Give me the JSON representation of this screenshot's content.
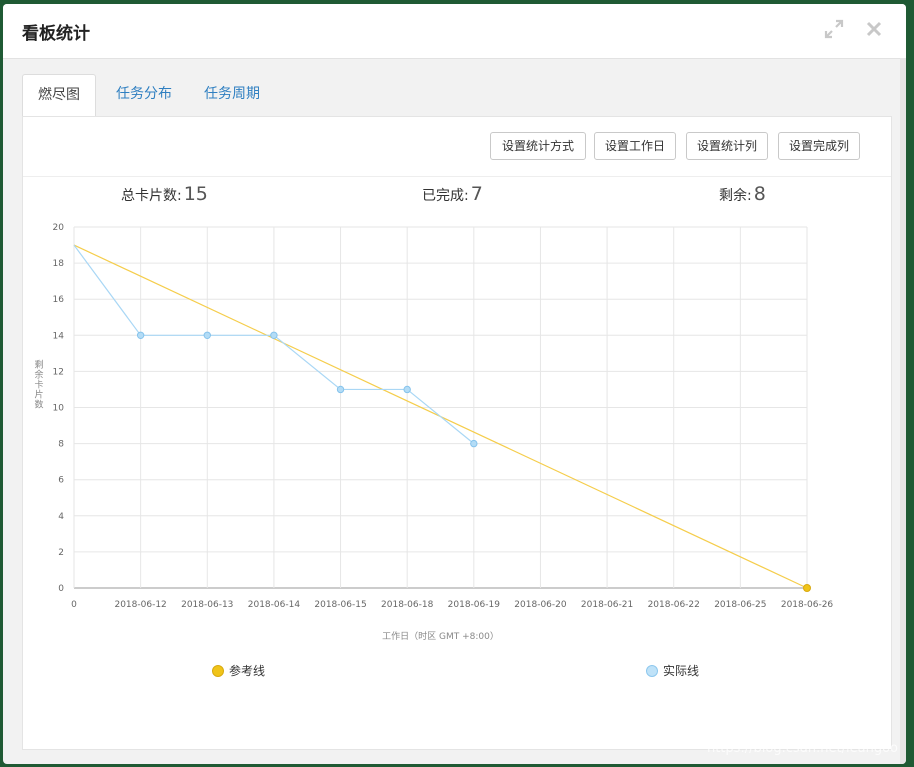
{
  "dialog": {
    "title": "看板统计",
    "icons": {
      "expand": "expand-icon",
      "close": "close-icon"
    }
  },
  "tabs": [
    {
      "label": "燃尽图",
      "active": true
    },
    {
      "label": "任务分布",
      "active": false
    },
    {
      "label": "任务周期",
      "active": false
    }
  ],
  "toolbar": {
    "buttons": [
      "设置统计方式",
      "设置工作日",
      "设置统计列",
      "设置完成列"
    ]
  },
  "stats": [
    {
      "label": "总卡片数:",
      "value": "15"
    },
    {
      "label": "已完成:",
      "value": "7"
    },
    {
      "label": "剩余:",
      "value": "8"
    }
  ],
  "chart_data": {
    "type": "line",
    "categories": [
      "0",
      "2018-06-12",
      "2018-06-13",
      "2018-06-14",
      "2018-06-15",
      "2018-06-18",
      "2018-06-19",
      "2018-06-20",
      "2018-06-21",
      "2018-06-22",
      "2018-06-25",
      "2018-06-26"
    ],
    "ylabel": "剩余卡片数",
    "xlabel": "工作日（时区 GMT +8:00）",
    "ylim": [
      0,
      20
    ],
    "yticks": [
      0,
      2,
      4,
      6,
      8,
      10,
      12,
      14,
      16,
      18,
      20
    ],
    "grid": true,
    "legend_position": "bottom",
    "series": [
      {
        "name": "参考线",
        "color": "#f5cd4b",
        "values": [
          19,
          null,
          null,
          null,
          null,
          null,
          null,
          null,
          null,
          null,
          null,
          0
        ]
      },
      {
        "name": "实际线",
        "color": "#a9d7f5",
        "values": [
          19,
          14,
          14,
          14,
          11,
          11,
          8,
          null,
          null,
          null,
          null,
          null
        ]
      }
    ]
  },
  "watermark": "https://blog.csdn.net/leangoo"
}
